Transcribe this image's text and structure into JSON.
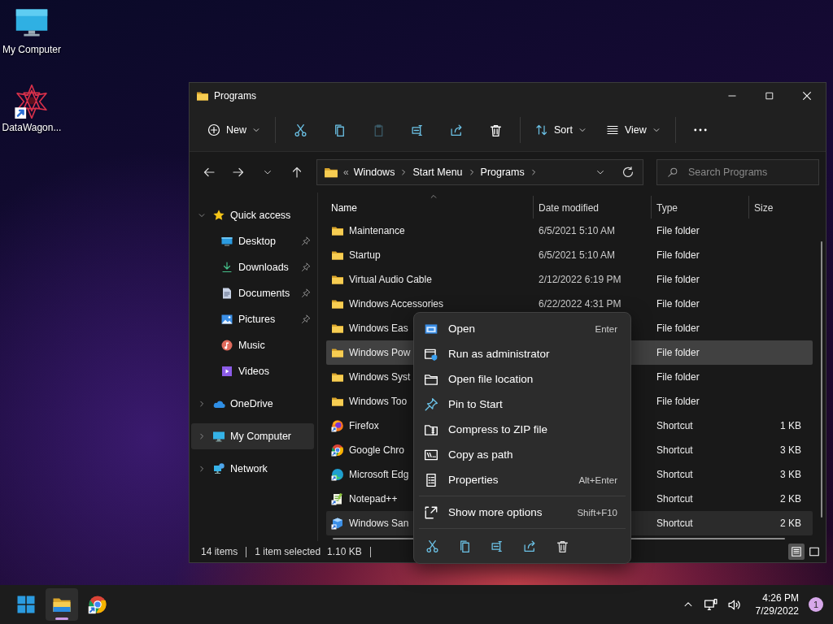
{
  "desktop_icons": [
    {
      "label": "My Computer",
      "kind": "computer"
    },
    {
      "label": "DataWagon...",
      "kind": "shortcut"
    }
  ],
  "window": {
    "title": "Programs"
  },
  "toolbar": {
    "groups": [
      {
        "items": [
          {
            "kind": "new",
            "label": "New",
            "disabled": false
          }
        ]
      },
      {
        "items": [
          {
            "kind": "cut",
            "disabled": false
          },
          {
            "kind": "copy",
            "disabled": false
          },
          {
            "kind": "paste",
            "disabled": true
          },
          {
            "kind": "rename",
            "disabled": false
          },
          {
            "kind": "share",
            "disabled": false
          },
          {
            "kind": "delete",
            "disabled": false
          }
        ]
      },
      {
        "items": [
          {
            "kind": "sort",
            "label": "Sort",
            "disabled": false
          },
          {
            "kind": "view",
            "label": "View",
            "disabled": false
          }
        ]
      },
      {
        "items": [
          {
            "kind": "more",
            "disabled": false
          }
        ]
      }
    ]
  },
  "address": {
    "overflow": "«",
    "crumbs": [
      "Windows",
      "Start Menu",
      "Programs"
    ]
  },
  "search": {
    "placeholder": "Search Programs"
  },
  "sidebar": {
    "items": [
      {
        "label": "Quick access",
        "kind": "star",
        "expanded": true,
        "selected": false,
        "children": [
          {
            "label": "Desktop",
            "kind": "desktop",
            "pinned": true,
            "selected": false
          },
          {
            "label": "Downloads",
            "kind": "download",
            "pinned": true,
            "selected": false
          },
          {
            "label": "Documents",
            "kind": "document",
            "pinned": true,
            "selected": false
          },
          {
            "label": "Pictures",
            "kind": "pictures",
            "pinned": true,
            "selected": false
          },
          {
            "label": "Music",
            "kind": "music",
            "pinned": false,
            "selected": false
          },
          {
            "label": "Videos",
            "kind": "videos",
            "pinned": false,
            "selected": false
          }
        ]
      },
      {
        "label": "OneDrive",
        "kind": "onedrive",
        "expanded": false,
        "selected": false
      },
      {
        "label": "My Computer",
        "kind": "computer",
        "expanded": false,
        "selected": true
      },
      {
        "label": "Network",
        "kind": "network",
        "expanded": false,
        "selected": false
      }
    ]
  },
  "table": {
    "columns": [
      {
        "label": "Name",
        "sorted": true
      },
      {
        "label": "Date modified",
        "sorted": false
      },
      {
        "label": "Type",
        "sorted": false
      },
      {
        "label": "Size",
        "sorted": false
      }
    ],
    "rows": [
      {
        "name": "Maintenance",
        "date": "6/5/2021 5:10 AM",
        "type": "File folder",
        "kind": "folder",
        "selected": false,
        "hovered": false
      },
      {
        "name": "Startup",
        "date": "6/5/2021 5:10 AM",
        "type": "File folder",
        "kind": "folder",
        "selected": false,
        "hovered": false
      },
      {
        "name": "Virtual Audio Cable",
        "date": "2/12/2022 6:19 PM",
        "type": "File folder",
        "kind": "folder",
        "selected": false,
        "hovered": false
      },
      {
        "name": "Windows Accessories",
        "date": "6/22/2022 4:31 PM",
        "type": "File folder",
        "kind": "folder",
        "selected": false,
        "hovered": false
      },
      {
        "name": "Windows Eas",
        "type": "File folder",
        "kind": "folder",
        "selected": false,
        "hovered": false
      },
      {
        "name": "Windows Pow",
        "type": "File folder",
        "kind": "folder",
        "selected": true,
        "hovered": false
      },
      {
        "name": "Windows Syst",
        "type": "File folder",
        "kind": "folder",
        "selected": false,
        "hovered": false
      },
      {
        "name": "Windows Too",
        "type": "File folder",
        "kind": "folder",
        "selected": false,
        "hovered": false
      },
      {
        "name": "Firefox",
        "type": "Shortcut",
        "size": "1 KB",
        "kind": "firefox",
        "selected": false,
        "hovered": false
      },
      {
        "name": "Google Chro",
        "type": "Shortcut",
        "size": "3 KB",
        "kind": "chrome",
        "selected": false,
        "hovered": false
      },
      {
        "name": "Microsoft Edg",
        "type": "Shortcut",
        "size": "3 KB",
        "kind": "edge",
        "selected": false,
        "hovered": false
      },
      {
        "name": "Notepad++",
        "type": "Shortcut",
        "size": "2 KB",
        "kind": "notepad",
        "selected": false,
        "hovered": false
      },
      {
        "name": "Windows San",
        "type": "Shortcut",
        "size": "2 KB",
        "kind": "sandbox",
        "selected": false,
        "hovered": true
      }
    ]
  },
  "status_bar": {
    "count": "14 items",
    "selection": "1 item selected",
    "size": "1.10 KB"
  },
  "view_modes": [
    {
      "kind": "details",
      "selected": true
    },
    {
      "kind": "tiles",
      "selected": false
    }
  ],
  "context_menu": {
    "items": [
      {
        "kind": "open",
        "label": "Open",
        "shortcut": "Enter"
      },
      {
        "kind": "runas",
        "label": "Run as administrator"
      },
      {
        "kind": "location",
        "label": "Open file location"
      },
      {
        "kind": "pin",
        "label": "Pin to Start"
      },
      {
        "kind": "zip",
        "label": "Compress to ZIP file"
      },
      {
        "kind": "copypath",
        "label": "Copy as path"
      },
      {
        "kind": "properties",
        "label": "Properties",
        "shortcut": "Alt+Enter"
      }
    ],
    "more": {
      "kind": "moreoptions",
      "label": "Show more options",
      "shortcut": "Shift+F10"
    },
    "actions": [
      {
        "kind": "cut"
      },
      {
        "kind": "copy"
      },
      {
        "kind": "rename"
      },
      {
        "kind": "share"
      },
      {
        "kind": "delete"
      }
    ]
  },
  "taskbar": {
    "apps": [
      {
        "kind": "start",
        "active": false
      },
      {
        "kind": "explorer",
        "active": true
      },
      {
        "kind": "chrome",
        "active": false
      }
    ],
    "time": "4:26 PM",
    "date": "7/29/2022",
    "notifications": "1"
  }
}
